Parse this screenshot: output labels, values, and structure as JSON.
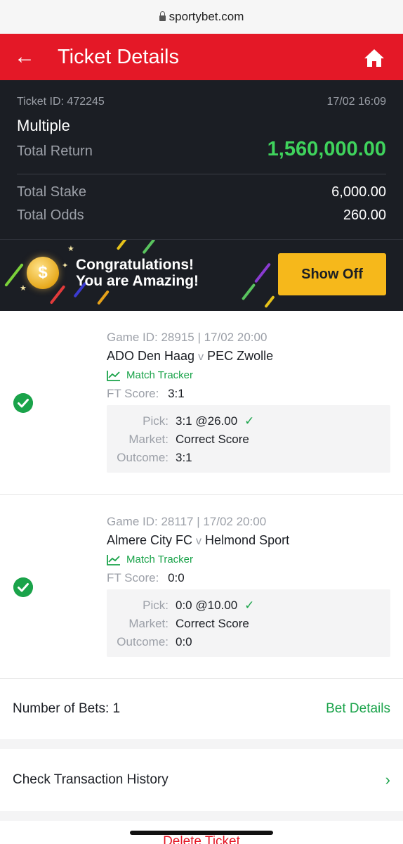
{
  "browser": {
    "url": "sportybet.com"
  },
  "header": {
    "title": "Ticket Details",
    "back_icon": "arrow-left-icon",
    "home_icon": "home-icon",
    "color": "#e41827"
  },
  "summary": {
    "ticket_id": "Ticket ID: 472245",
    "datetime": "17/02 16:09",
    "type": "Multiple",
    "total_return_label": "Total Return",
    "total_return": "1,560,000.00",
    "total_stake_label": "Total Stake",
    "total_stake": "6,000.00",
    "total_odds_label": "Total Odds",
    "total_odds": "260.00"
  },
  "promo": {
    "line1": "Congratulations!",
    "line2": "You are Amazing!",
    "button": "Show Off"
  },
  "bets": [
    {
      "game": "Game ID: 28915 | 17/02 20:00",
      "home": "ADO Den Haag",
      "vs": "v",
      "away": "PEC Zwolle",
      "tracker": "Match Tracker",
      "ft_label": "FT Score:",
      "ft_score": "3:1",
      "pick_label": "Pick:",
      "pick": "3:1 @26.00",
      "market_label": "Market:",
      "market": "Correct Score",
      "outcome_label": "Outcome:",
      "outcome": "3:1"
    },
    {
      "game": "Game ID: 28117 | 17/02 20:00",
      "home": "Almere City FC",
      "vs": "v",
      "away": "Helmond Sport",
      "tracker": "Match Tracker",
      "ft_label": "FT Score:",
      "ft_score": "0:0",
      "pick_label": "Pick:",
      "pick": "0:0 @10.00",
      "market_label": "Market:",
      "market": "Correct Score",
      "outcome_label": "Outcome:",
      "outcome": "0:0"
    }
  ],
  "footer": {
    "number_of_bets": "Number of Bets: 1",
    "bet_details": "Bet Details",
    "history": "Check Transaction History",
    "delete": "Delete Ticket"
  },
  "colors": {
    "accent_green": "#1aa34a",
    "return_green": "#3fd35c",
    "dark_bg": "#1b1e24",
    "promo_button": "#f6b81b"
  }
}
